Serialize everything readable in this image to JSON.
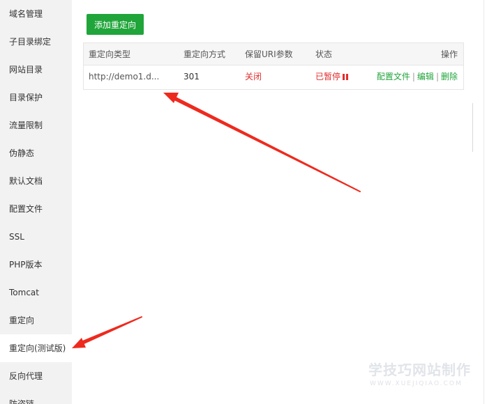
{
  "sidebar": {
    "items": [
      {
        "label": "域名管理"
      },
      {
        "label": "子目录绑定"
      },
      {
        "label": "网站目录"
      },
      {
        "label": "目录保护"
      },
      {
        "label": "流量限制"
      },
      {
        "label": "伪静态"
      },
      {
        "label": "默认文档"
      },
      {
        "label": "配置文件"
      },
      {
        "label": "SSL"
      },
      {
        "label": "PHP版本"
      },
      {
        "label": "Tomcat"
      },
      {
        "label": "重定向"
      },
      {
        "label": "重定向(测试版)"
      },
      {
        "label": "反向代理"
      },
      {
        "label": "防盗链"
      }
    ],
    "active_index": 12
  },
  "toolbar": {
    "add_label": "添加重定向"
  },
  "table": {
    "headers": [
      "重定向类型",
      "重定向方式",
      "保留URI参数",
      "状态",
      "操作"
    ],
    "rows": [
      {
        "type": "http://demo1.d...",
        "method": "301",
        "keep_uri": "关闭",
        "status": "已暂停",
        "actions": {
          "config": "配置文件",
          "edit": "编辑",
          "delete": "删除",
          "separator": "|"
        }
      }
    ]
  },
  "watermark": {
    "main": "学技巧网站制作",
    "sub": "WWW.XUEJIQIAO.COM"
  },
  "colors": {
    "accent": "#20a53a",
    "danger": "#e12e2e",
    "annotation_arrow": "#ee2a1e"
  }
}
